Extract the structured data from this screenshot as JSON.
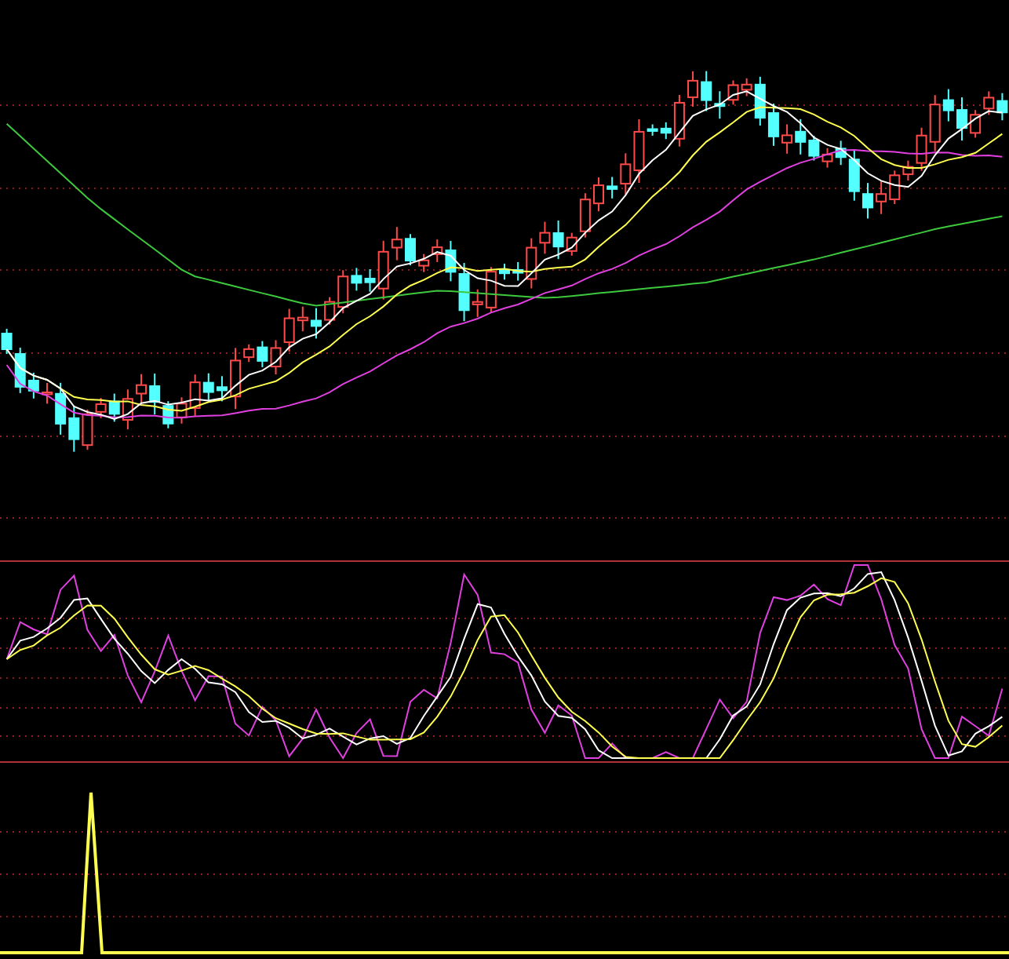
{
  "panels": [
    {
      "kind": "candlestick"
    },
    {
      "kind": "oscillator"
    },
    {
      "kind": "signal"
    }
  ]
}
